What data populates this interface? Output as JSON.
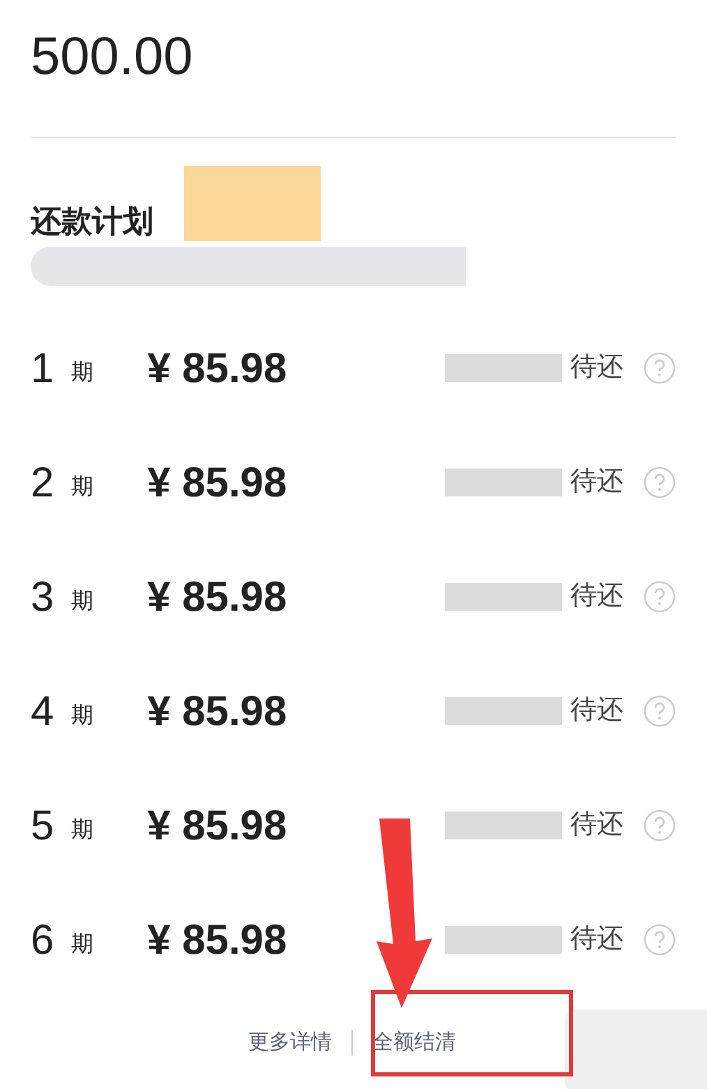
{
  "amount": "500.00",
  "plan": {
    "title": "还款计划"
  },
  "installments": [
    {
      "period": "1",
      "unit": "期",
      "amount": "¥ 85.98",
      "status": "待还"
    },
    {
      "period": "2",
      "unit": "期",
      "amount": "¥ 85.98",
      "status": "待还"
    },
    {
      "period": "3",
      "unit": "期",
      "amount": "¥ 85.98",
      "status": "待还"
    },
    {
      "period": "4",
      "unit": "期",
      "amount": "¥ 85.98",
      "status": "待还"
    },
    {
      "period": "5",
      "unit": "期",
      "amount": "¥ 85.98",
      "status": "待还"
    },
    {
      "period": "6",
      "unit": "期",
      "amount": "¥ 85.98",
      "status": "待还"
    }
  ],
  "footer": {
    "links": [
      "更多详情",
      "全额结清"
    ]
  }
}
